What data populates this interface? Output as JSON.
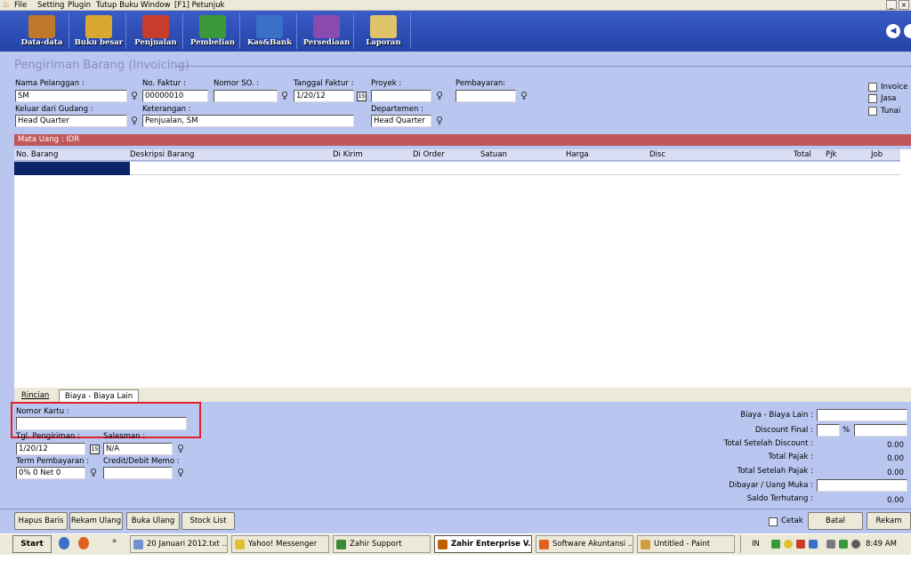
{
  "menu": {
    "items": [
      "File",
      "Setting",
      "Plugin",
      "Tutup Buku",
      "Window",
      "[F1] Petunjuk"
    ],
    "window_buttons": [
      "_",
      "×"
    ]
  },
  "toolbar": {
    "buttons": [
      {
        "label": "Data-data",
        "icon": "data-data-icon",
        "color": "#c0782a"
      },
      {
        "label": "Buku besar",
        "icon": "ledger-book-icon",
        "color": "#d9a830"
      },
      {
        "label": "Penjualan",
        "icon": "sales-cart-icon",
        "color": "#c83c2c"
      },
      {
        "label": "Pembelian",
        "icon": "purchase-icon",
        "color": "#3a9a3a"
      },
      {
        "label": "Kas&Bank",
        "icon": "cash-bank-icon",
        "color": "#3a70c8"
      },
      {
        "label": "Persediaan",
        "icon": "inventory-icon",
        "color": "#8a4ab0"
      },
      {
        "label": "Laporan",
        "icon": "report-scroll-icon",
        "color": "#e0c46a"
      }
    ],
    "nav_icon": "◀"
  },
  "form": {
    "title": "Pengiriman Barang (Invoicing)",
    "nama_pelanggan": {
      "label": "Nama Pelanggan :",
      "value": "SM"
    },
    "no_faktur": {
      "label": "No. Faktur :",
      "value": "00000010"
    },
    "nomor_so": {
      "label": "Nomor SO. :",
      "value": ""
    },
    "tanggal_faktur": {
      "label": "Tanggal Faktur :",
      "value": "1/20/12"
    },
    "proyek": {
      "label": "Proyek :",
      "value": ""
    },
    "pembayaran": {
      "label": "Pembayaran:",
      "value": ""
    },
    "keluar_gudang": {
      "label": "Keluar dari Gudang :",
      "value": "Head Quarter"
    },
    "keterangan": {
      "label": "Keterangan :",
      "value": "Penjualan, SM"
    },
    "departemen": {
      "label": "Departemen :",
      "value": "Head Quarter"
    },
    "checkboxes": [
      "Invoice",
      "Jasa",
      "Tunai"
    ],
    "cal_icon": "15",
    "pick_icon": "♀"
  },
  "currency_bar": "Mata Uang : IDR",
  "grid": {
    "columns": [
      "No. Barang",
      "Deskripsi Barang",
      "Di Kirim",
      "Di Order",
      "Satuan",
      "Harga",
      "Disc",
      "Total",
      "Pjk",
      "Job"
    ]
  },
  "tabs": {
    "rincian": "Rincian",
    "biaya": "Biaya - Biaya Lain"
  },
  "lower": {
    "nomor_kartu": {
      "label": "Nomor Kartu :",
      "value": ""
    },
    "tgl_pengiriman": {
      "label": "Tgl. Pengiriman :",
      "value": "1/20/12"
    },
    "salesman": {
      "label": "Salesman :",
      "value": "N/A"
    },
    "term_pembayaran": {
      "label": "Term Pembayaran :",
      "value": "0% 0 Net 0"
    },
    "credit_memo": {
      "label": "Credit/Debit Memo :",
      "value": ""
    },
    "summary": {
      "biaya_lain": {
        "label": "Biaya - Biaya Lain :",
        "value": ""
      },
      "discount_final": {
        "label": "Discount Final :",
        "value": "",
        "percent": "%"
      },
      "setelah_discount": {
        "label": "Total Setelah Discount :",
        "value": "0.00"
      },
      "total_pajak": {
        "label": "Total Pajak :",
        "value": "0.00"
      },
      "setelah_pajak": {
        "label": "Total Setelah Pajak :",
        "value": "0.00"
      },
      "dibayar": {
        "label": "Dibayar / Uang Muka :",
        "value": ""
      },
      "saldo": {
        "label": "Saldo Terhutang :",
        "value": "0.00"
      }
    }
  },
  "buttons": {
    "hapus_baris": "Hapus Baris",
    "rekam_ulang": "Rekam Ulang",
    "buka_ulang": "Buka Ulang",
    "stock_list": "Stock List",
    "cetak": "Cetak",
    "batal": "Batal",
    "rekam": "Rekam"
  },
  "taskbar": {
    "start": "Start",
    "chevron": "»",
    "tasks": [
      {
        "label": "20 Januari 2012.txt ...",
        "color": "#7090d0"
      },
      {
        "label": "Yahoo! Messenger",
        "color": "#e0c030"
      },
      {
        "label": "Zahir Support",
        "color": "#3a8a3a"
      },
      {
        "label": "Zahir Enterprise V...",
        "color": "#c06000"
      },
      {
        "label": "Software Akuntansi ...",
        "color": "#e06020"
      },
      {
        "label": "Untitled - Paint",
        "color": "#d0a040"
      }
    ],
    "lang": "IN",
    "clock": "8:49 AM"
  }
}
